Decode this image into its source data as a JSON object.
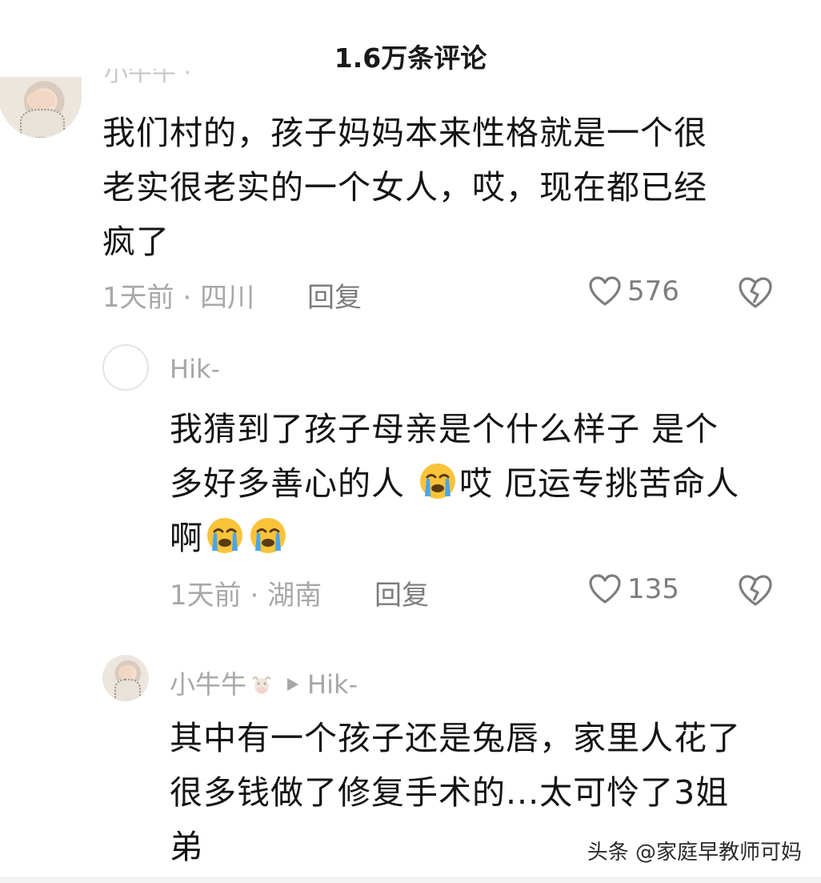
{
  "header": {
    "title": "1.6万条评论"
  },
  "comments": [
    {
      "text": "我们村的，孩子妈妈本来性格就是一个很老实很老实的一个女人，哎，现在都已经疯了",
      "lines": [
        "我们村的，孩子妈妈本来性格就是一个很",
        "老实很老实的一个女人，哎，现在都已经",
        "疯了"
      ],
      "time": "1天前",
      "location": "四川",
      "reply_label": "回复",
      "likes": "576"
    },
    {
      "username": "Hik-",
      "lines": [
        {
          "before": "我猜到了孩子母亲是个什么样子 是个",
          "emoji": 0,
          "after": ""
        },
        {
          "before": "多好多善心的人 ",
          "emoji": 1,
          "after": "哎 厄运专挑苦命人"
        },
        {
          "before": "啊",
          "emoji": 2,
          "after": ""
        }
      ],
      "time": "1天前",
      "location": "湖南",
      "reply_label": "回复",
      "likes": "135"
    },
    {
      "username": "小牛牛",
      "reply_to": "Hik-",
      "lines": [
        "其中有一个孩子还是兔唇，家里人花了",
        "很多钱做了修复手术的...太可怜了3姐",
        "弟"
      ]
    }
  ],
  "icons": {
    "like": "heart-outline-icon",
    "dislike": "broken-heart-icon",
    "emoji": "loudly-crying-face-icon",
    "username_badge": "cow-face-icon",
    "reply_arrow": "play-arrow-icon"
  },
  "colors": {
    "text": "#141414",
    "muted": "#a8a8a8",
    "action": "#7d7d7d",
    "emoji_face": "#f9c33a",
    "emoji_tears": "#4aa5e8"
  },
  "watermark": "头条 @家庭早教师可妈"
}
